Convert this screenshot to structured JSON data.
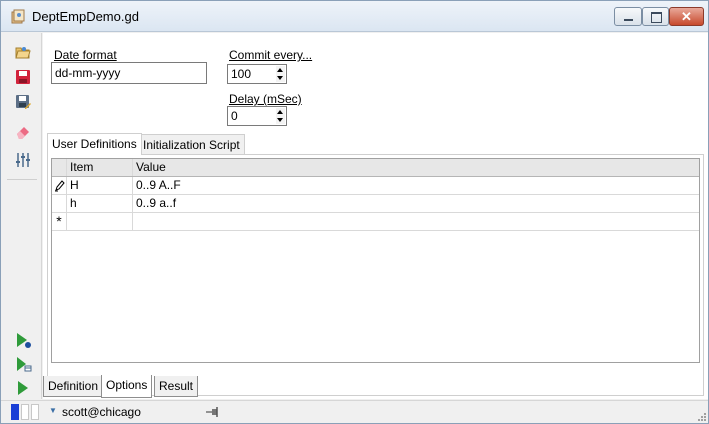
{
  "window": {
    "title": "DeptEmpDemo.gd"
  },
  "form": {
    "date_format_label": "Date format",
    "date_format_value": "dd-mm-yyyy",
    "commit_label": "Commit every...",
    "commit_value": "100",
    "delay_label": "Delay (mSec)",
    "delay_value": "0"
  },
  "tabs": [
    "User Definitions",
    "Initialization Script"
  ],
  "grid": {
    "headers": [
      "Item",
      "Value"
    ],
    "rows": [
      {
        "indicator": "edit-pencil-icon",
        "item": "H",
        "value": "0..9 A..F"
      },
      {
        "indicator": "",
        "item": "h",
        "value": "0..9 a..f"
      }
    ],
    "new_row_marker": "*"
  },
  "bottom_tabs": [
    "Definition",
    "Options",
    "Result"
  ],
  "active_bottom_tab": "Options",
  "status": {
    "connection": "scott@chicago"
  },
  "colors": {
    "accent_blue": "#1a3fd6",
    "play_green": "#2f9b3a",
    "close_red": "#c7492c"
  },
  "icons": [
    "open-folder-icon",
    "save-icon",
    "save-as-icon",
    "eraser-icon",
    "settings-sliders-icon",
    "run-step-icon",
    "run-to-table-icon",
    "run-icon",
    "pin-icon"
  ]
}
